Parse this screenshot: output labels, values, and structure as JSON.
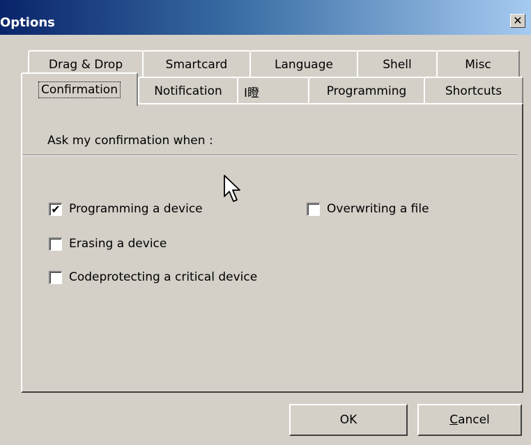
{
  "window": {
    "title": "Options",
    "close_glyph": "✕"
  },
  "tabs": {
    "row1": [
      "Drag & Drop",
      "Smartcard",
      "Language",
      "Shell",
      "Misc"
    ],
    "row2": [
      "Confirmation",
      "Notification",
      "I瞪",
      "Programming",
      "Shortcuts"
    ],
    "active": "Confirmation"
  },
  "confirmation": {
    "section_label": "Ask my confirmation when :",
    "checkboxes": [
      {
        "label": "Programming a device",
        "checked": true
      },
      {
        "label": "Erasing a device",
        "checked": false
      },
      {
        "label": "Codeprotecting a critical device",
        "checked": false
      },
      {
        "label": "Overwriting a file",
        "checked": false
      }
    ]
  },
  "buttons": {
    "ok": "OK",
    "cancel": "Cancel"
  },
  "colors": {
    "face": "#d4d0c8",
    "title_start": "#0a246a",
    "title_end": "#a6caf0"
  }
}
